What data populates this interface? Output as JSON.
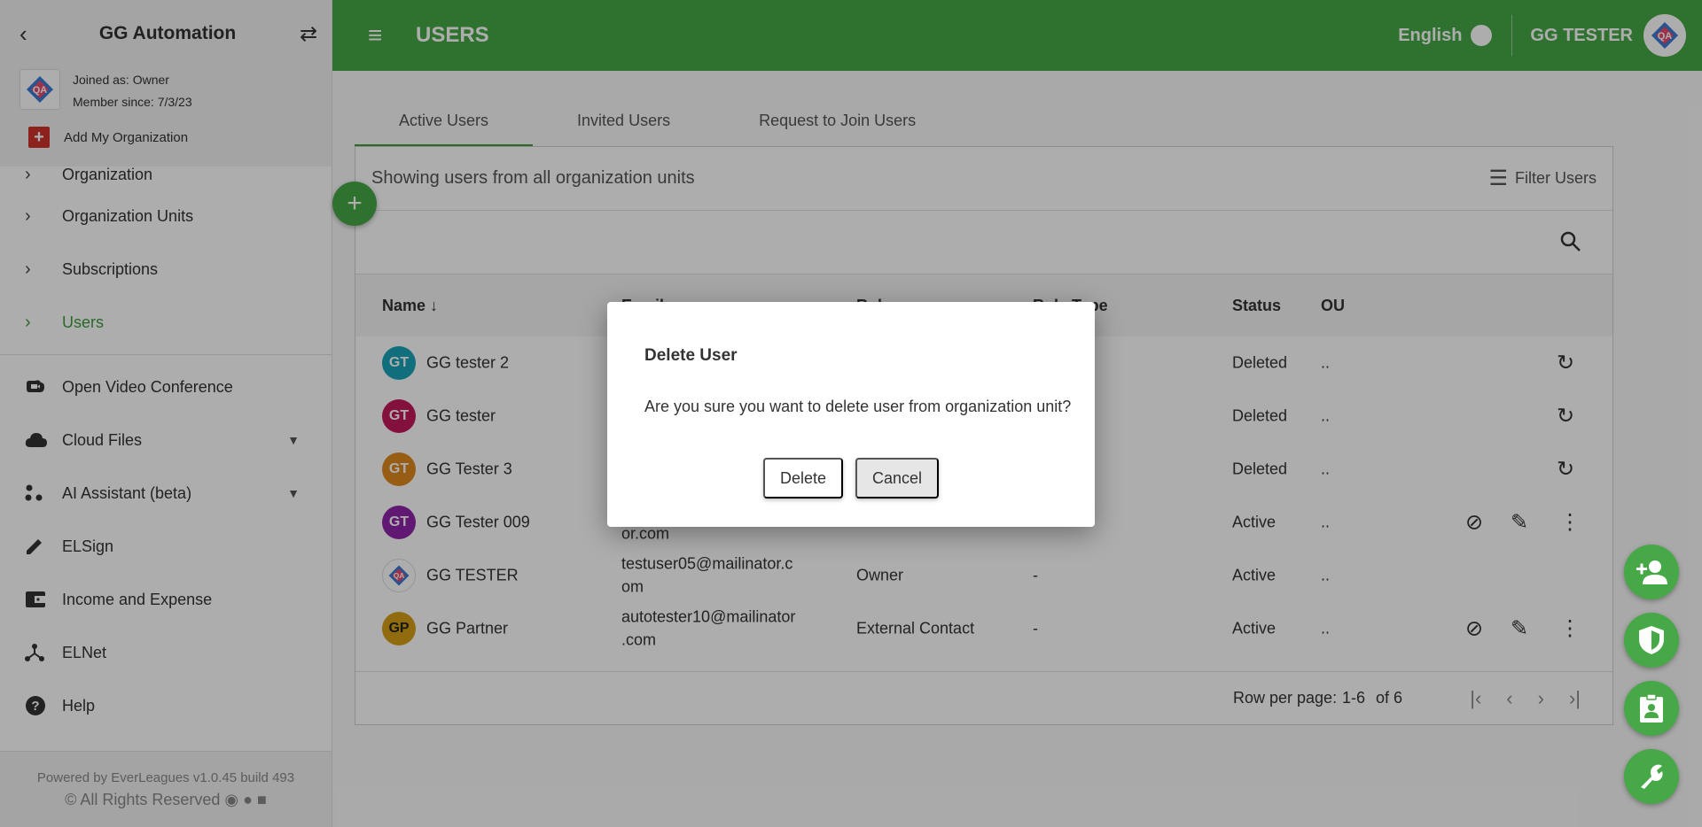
{
  "sidebar": {
    "org_name": "GG Automation",
    "joined": "Joined as: Owner",
    "member_since": "Member since: 7/3/23",
    "add_org": "Add My Organization",
    "items": [
      {
        "label": "Organization"
      },
      {
        "label": "Organization Units"
      },
      {
        "label": "Subscriptions"
      },
      {
        "label": "Users"
      },
      {
        "label": "Open Video Conference"
      },
      {
        "label": "Cloud Files"
      },
      {
        "label": "AI Assistant (beta)"
      },
      {
        "label": "ELSign"
      },
      {
        "label": "Income and Expense"
      },
      {
        "label": "ELNet"
      },
      {
        "label": "Help"
      }
    ],
    "footer_line1": "Powered by EverLeagues v1.0.45 build 493",
    "footer_line2": "© All Rights Reserved"
  },
  "header": {
    "title": "USERS",
    "language": "English",
    "user": "GG TESTER"
  },
  "tabs": [
    {
      "label": "Active Users"
    },
    {
      "label": "Invited Users"
    },
    {
      "label": "Request to Join Users"
    }
  ],
  "card": {
    "showing": "Showing users from all organization units",
    "filter": "Filter Users"
  },
  "table": {
    "columns": {
      "name": "Name",
      "email": "Email",
      "role": "Role",
      "role_type": "Role Type",
      "status": "Status",
      "ou": "OU"
    },
    "rows": [
      {
        "initials": "GT",
        "color": "#1aa3b8",
        "name": "GG tester 2",
        "email": "",
        "email2": "",
        "role": "",
        "role_type": "",
        "status": "Deleted",
        "ou": ".."
      },
      {
        "initials": "GT",
        "color": "#c2185b",
        "name": "GG tester",
        "email": "",
        "email2": "",
        "role": "",
        "role_type": "",
        "status": "Deleted",
        "ou": ".."
      },
      {
        "initials": "GT",
        "color": "#e08a1e",
        "name": "GG Tester 3",
        "email": "",
        "email2": "",
        "role": "",
        "role_type": "",
        "status": "Deleted",
        "ou": ".."
      },
      {
        "initials": "GT",
        "color": "#8e24aa",
        "name": "GG Tester 009",
        "email": "",
        "email2": "or.com",
        "role": "",
        "role_type": "",
        "status": "Active",
        "ou": ".."
      },
      {
        "initials": "",
        "color": "#ffffff",
        "name": "GG TESTER",
        "email": "testuser05@mailinator.c",
        "email2": "om",
        "role": "Owner",
        "role_type": "-",
        "status": "Active",
        "ou": ".."
      },
      {
        "initials": "GP",
        "color": "#d4a017",
        "name": "GG Partner",
        "email": "autotester10@mailinator",
        "email2": ".com",
        "role": "External Contact",
        "role_type": "-",
        "status": "Active",
        "ou": ".."
      }
    ],
    "rows_per_page": "Row per page:",
    "range": "1-6",
    "of": "of 6"
  },
  "dialog": {
    "title": "Delete User",
    "message": "Are you sure you want to delete user from organization unit?",
    "delete_label": "Delete",
    "cancel_label": "Cancel"
  }
}
